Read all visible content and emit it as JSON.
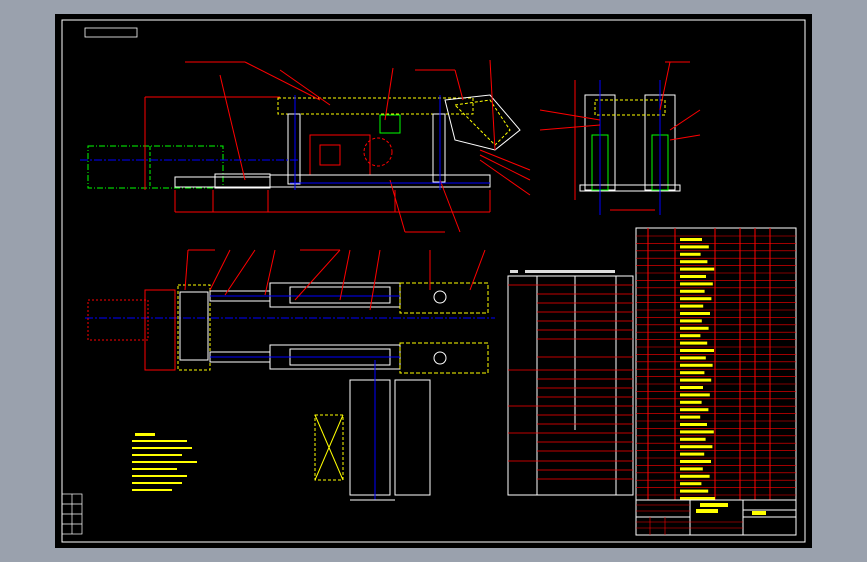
{
  "viewer": {
    "background_color": "#9aa1ad",
    "canvas_color": "#000000"
  },
  "drawing": {
    "line_colors": {
      "outline": "#ffffff",
      "dimension": "#ff0000",
      "hidden": "#00ff00",
      "center": "#0000ff",
      "annotation": "#ffff00",
      "highlight": "#00ffff"
    },
    "views": [
      "side-elevation",
      "end-view",
      "plan-view",
      "technical-spec-table",
      "parts-list",
      "title-block",
      "technical-notes"
    ]
  }
}
